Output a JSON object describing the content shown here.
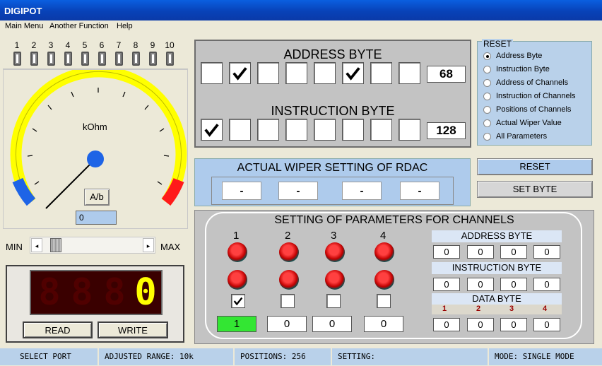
{
  "window": {
    "title": "DIGIPOT"
  },
  "menu": [
    "Main Menu",
    "Another Function",
    "Help"
  ],
  "leds": [
    "1",
    "2",
    "3",
    "4",
    "5",
    "6",
    "7",
    "8",
    "9",
    "10"
  ],
  "gauge": {
    "unit": "kOhm",
    "mode_button": "A/b",
    "value": "0"
  },
  "slider": {
    "min_label": "MIN",
    "max_label": "MAX",
    "position": 0.08
  },
  "display": {
    "digits": [
      "8",
      "8",
      "8",
      "0"
    ],
    "read_label": "READ",
    "write_label": "WRITE"
  },
  "address_byte": {
    "title": "ADDRESS BYTE",
    "bits": [
      false,
      true,
      false,
      false,
      false,
      true,
      false,
      false
    ],
    "value": "68"
  },
  "instruction_byte": {
    "title": "INSTRUCTION BYTE",
    "bits": [
      true,
      false,
      false,
      false,
      false,
      false,
      false,
      false
    ],
    "value": "128"
  },
  "reset_group": {
    "title": "RESET",
    "options": [
      "Address Byte",
      "Instruction Byte",
      "Address of Channels",
      "Instruction of Channels",
      "Positions of Channels",
      "Actual  Wiper Value",
      "All Parameters"
    ],
    "selected": 0
  },
  "wiper": {
    "title": "ACTUAL WIPER SETTING OF RDAC",
    "values": [
      "-",
      "-",
      "-",
      "-"
    ]
  },
  "buttons": {
    "reset": "RESET",
    "set_byte": "SET BYTE"
  },
  "channels": {
    "title": "SETTING OF PARAMETERS FOR CHANNELS",
    "labels": [
      "1",
      "2",
      "3",
      "4"
    ],
    "checks": [
      true,
      false,
      false,
      false
    ],
    "values": [
      "1",
      "0",
      "0",
      "0"
    ],
    "address_title": "ADDRESS BYTE",
    "address_values": [
      "0",
      "0",
      "0",
      "0"
    ],
    "instruction_title": "INSTRUCTION BYTE",
    "instruction_values": [
      "0",
      "0",
      "0",
      "0"
    ],
    "data_title": "DATA BYTE",
    "data_labels": [
      "1",
      "2",
      "3",
      "4"
    ],
    "data_values": [
      "0",
      "0",
      "0",
      "0"
    ]
  },
  "status": {
    "port": "SELECT PORT",
    "range": "ADJUSTED RANGE: 10k",
    "positions": "POSITIONS: 256",
    "setting": "SETTING:",
    "mode": "MODE: SINGLE MODE"
  },
  "colors": {
    "accent": "#0a48c8",
    "panel_blue": "#aecbec",
    "gauge_yellow": "#ffff00",
    "gauge_blue": "#1e64e6",
    "gauge_red": "#ff1a1a",
    "active_green": "#33e633"
  }
}
